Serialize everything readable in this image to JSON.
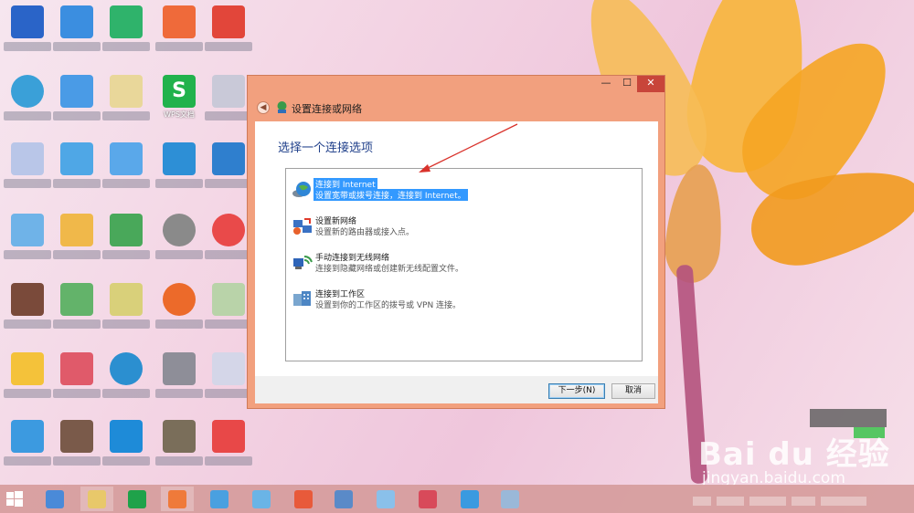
{
  "dialog": {
    "window_controls": {
      "minimize": "—",
      "maximize": "☐",
      "close": "✕"
    },
    "back_icon": "back-arrow-icon",
    "header_icon": "network-setup-icon",
    "header_title": "设置连接或网络",
    "instruction": "选择一个连接选项",
    "options": [
      {
        "title": "连接到 Internet",
        "description": "设置宽带或拨号连接，连接到 Internet。",
        "icon": "globe-icon",
        "selected": true
      },
      {
        "title": "设置新网络",
        "description": "设置新的路由器或接入点。",
        "icon": "router-icon",
        "selected": false
      },
      {
        "title": "手动连接到无线网络",
        "description": "连接到隐藏网络或创建新无线配置文件。",
        "icon": "wireless-icon",
        "selected": false
      },
      {
        "title": "连接到工作区",
        "description": "设置到你的工作区的拨号或 VPN 连接。",
        "icon": "workplace-icon",
        "selected": false
      }
    ],
    "buttons": {
      "next": "下一步(N)",
      "cancel": "取消"
    }
  },
  "desktop": {
    "visible_icon_labels": [
      "WPS文档"
    ]
  },
  "colors": {
    "dialog_frame": "#f2a07e",
    "close_button": "#c8453a",
    "selection": "#3399ff",
    "instruction_text": "#1f3f8a",
    "annotation_arrow": "#d9322b"
  },
  "watermark": {
    "logo": "Bai du 经验",
    "url": "jingyan.baidu.com"
  }
}
